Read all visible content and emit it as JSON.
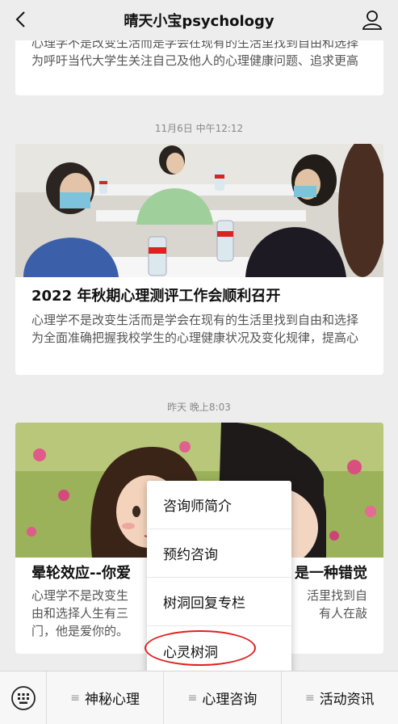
{
  "header": {
    "title": "晴天小宝psychology"
  },
  "feed": {
    "card1": {
      "desc": "心理学不是改变生活而是学会在现有的生活里找到自由和选择为呼吁当代大学生关注自己及他人的心理健康问题、追求更高"
    },
    "timestamp1": "11月6日 中午12:12",
    "card2": {
      "title": "2022 年秋期心理测评工作会顺利召开",
      "desc": "心理学不是改变生活而是学会在现有的生活里找到自由和选择为全面准确把握我校学生的心理健康状况及变化规律，提高心"
    },
    "timestamp2": "昨天 晚上8:03",
    "card3": {
      "title": "晕轮效应--你爱",
      "title_right": "是一种错觉",
      "desc_left": "心理学不是改变生活而是学会在现有的生活里找到自由和选择人生有三大",
      "desc_line1_left": "心理学不是改变生",
      "desc_line1_right": "活里找到自",
      "desc_line2_left": "由和选择人生有三",
      "desc_line2_right": "有人在敲",
      "desc_line3": "门，他是爱你的。"
    }
  },
  "popup": {
    "items": [
      "咨询师简介",
      "预约咨询",
      "树洞回复专栏",
      "心灵树洞"
    ]
  },
  "bottom": {
    "tabs": [
      "神秘心理",
      "心理咨询",
      "活动资讯"
    ]
  },
  "colors": {
    "highlight": "#e02020"
  }
}
